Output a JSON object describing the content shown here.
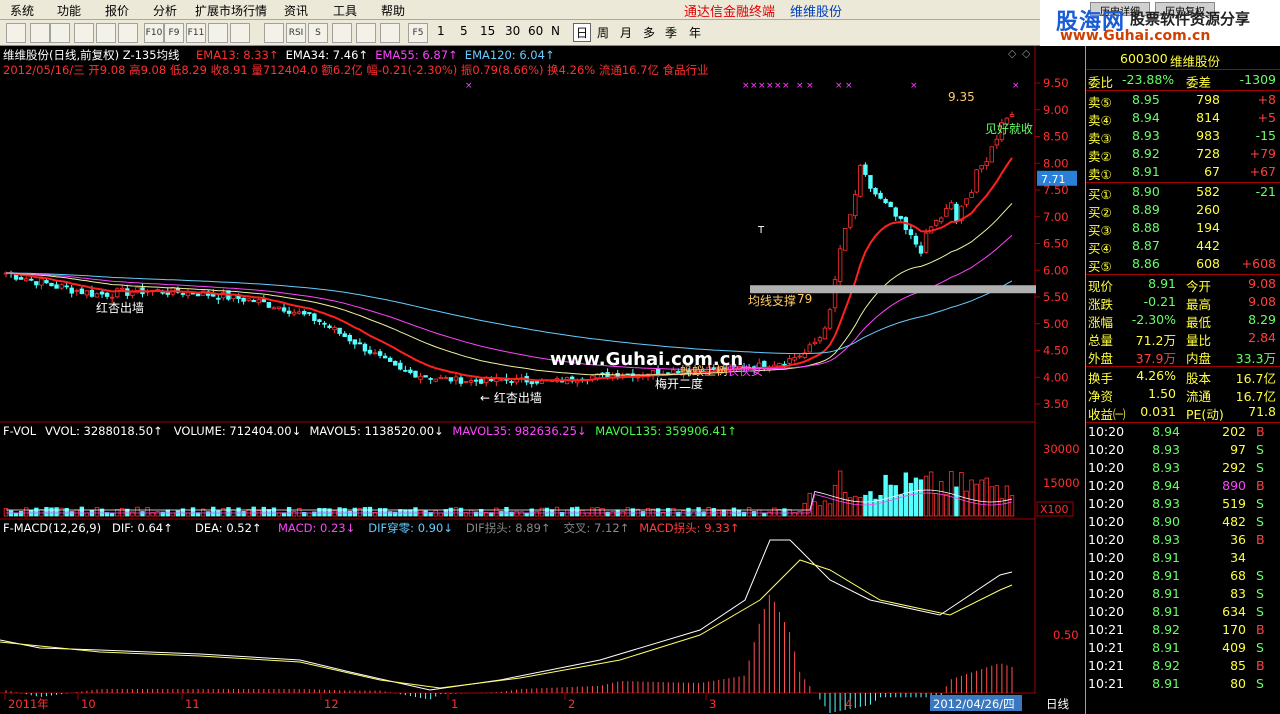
{
  "menu": [
    "系统",
    "功能",
    "报价",
    "分析",
    "扩展市场行情",
    "资讯",
    "工具",
    "帮助"
  ],
  "promo": "通达信金融终端",
  "stock_name_top": "维维股份",
  "brand": {
    "logo": "股海网",
    "slogan": "股票软件资源分享",
    "url": "www.Guhai.com.cn",
    "tabs": [
      "历史详细",
      "历史复权"
    ]
  },
  "toolbar": {
    "icons": [
      "k-line-icon",
      "bar-icon",
      "trend-icon",
      "candle-icon",
      "window-icon",
      "grid-icon",
      "f10-icon",
      "f9-icon",
      "f11-icon",
      "chart-icon",
      "comp-icon",
      "indicator-icon",
      "rsi-icon",
      "s-icon",
      "move-icon",
      "export-icon",
      "pen-icon",
      "f5-icon"
    ],
    "icon_labels": [
      "",
      "",
      "",
      "",
      "",
      "",
      "F10",
      "F9",
      "F11",
      "",
      "",
      "",
      "RSI",
      "S",
      "",
      "",
      "",
      "F5"
    ],
    "periods": [
      "1",
      "5",
      "15",
      "30",
      "60",
      "N",
      "日",
      "周",
      "月",
      "多",
      "季",
      "年"
    ],
    "selected_period": "日"
  },
  "price_panel": {
    "title": "维维股份(日线,前复权)",
    "indicator": "Z-135均线",
    "emas": [
      {
        "label": "EMA13: 8.33",
        "color": "#ff3030"
      },
      {
        "label": "EMA34: 7.46",
        "color": "#ffffff"
      },
      {
        "label": "EMA55: 6.87",
        "color": "#ff44ff"
      },
      {
        "label": "EMA120: 6.04",
        "color": "#66ccff"
      }
    ],
    "info_line": "2012/05/16/三 开9.08 高9.08 低8.29 收8.91 量712404.0 额6.2亿 幅-0.21(-2.30%) 振0.79(8.66%) 换4.26% 流通16.7亿 食品行业",
    "y_ticks": [
      "9.50",
      "9.00",
      "8.50",
      "8.00",
      "7.50",
      "7.00",
      "6.50",
      "6.00",
      "5.50",
      "5.00",
      "4.50",
      "4.00",
      "3.50"
    ],
    "current_price_tag": "7.71",
    "annotations": {
      "high_label": "9.35",
      "sell_signal": "见好就收",
      "red_apricot_1": "红杏出墙",
      "red_apricot_2": "红杏出墙",
      "plum": "梅开二度",
      "ant": "蚂蚁上树",
      "heroine": "农侠女",
      "ma_support": "均线支撑",
      "support_val": "79",
      "marker": "T"
    },
    "watermark": "www.Guhai.com.cn"
  },
  "vol_panel": {
    "title": "F-VOL",
    "labels": [
      {
        "label": "VVOL: 3288018.50↑",
        "color": "#ffffff"
      },
      {
        "label": "VOLUME: 712404.00↓",
        "color": "#ffffff"
      },
      {
        "label": "MAVOL5: 1138520.00↓",
        "color": "#ffffff"
      },
      {
        "label": "MAVOL35: 982636.25↓",
        "color": "#ff44ff"
      },
      {
        "label": "MAVOL135: 359906.41↑",
        "color": "#44ff44"
      }
    ],
    "y_ticks": [
      "30000",
      "15000",
      "X100"
    ]
  },
  "macd_panel": {
    "title": "F-MACD(12,26,9)",
    "labels": [
      {
        "label": "DIF: 0.64↑",
        "color": "#ffffff"
      },
      {
        "label": "DEA: 0.52↑",
        "color": "#ffffff"
      },
      {
        "label": "MACD: 0.23↓",
        "color": "#ff44ff"
      },
      {
        "label": "DIF穿零: 0.90↓",
        "color": "#66ccff"
      },
      {
        "label": "DIF拐头: 8.89↑",
        "color": "#888888"
      },
      {
        "label": "交叉: 7.12↑",
        "color": "#888888"
      },
      {
        "label": "MACD拐头: 9.33↑",
        "color": "#ff4040"
      }
    ],
    "y_tick": "0.50"
  },
  "x_axis": {
    "labels": [
      "2011年",
      "10",
      "11",
      "12",
      "1",
      "2",
      "3",
      "4"
    ],
    "date_box": "2012/04/26/四",
    "period": "日线"
  },
  "quote": {
    "code": "600300",
    "name": "维维股份",
    "weibi_label": "委比",
    "weibi": "-23.88%",
    "weicha_label": "委差",
    "weicha": "-1309",
    "asks": [
      {
        "label": "卖⑤",
        "price": "8.95",
        "vol": "798",
        "chg": "+8"
      },
      {
        "label": "卖④",
        "price": "8.94",
        "vol": "814",
        "chg": "+5"
      },
      {
        "label": "卖③",
        "price": "8.93",
        "vol": "983",
        "chg": "-15"
      },
      {
        "label": "卖②",
        "price": "8.92",
        "vol": "728",
        "chg": "+79"
      },
      {
        "label": "卖①",
        "price": "8.91",
        "vol": "67",
        "chg": "+67"
      }
    ],
    "bids": [
      {
        "label": "买①",
        "price": "8.90",
        "vol": "582",
        "chg": "-21"
      },
      {
        "label": "买②",
        "price": "8.89",
        "vol": "260",
        "chg": ""
      },
      {
        "label": "买③",
        "price": "8.88",
        "vol": "194",
        "chg": ""
      },
      {
        "label": "买④",
        "price": "8.87",
        "vol": "442",
        "chg": ""
      },
      {
        "label": "买⑤",
        "price": "8.86",
        "vol": "608",
        "chg": "+608"
      }
    ],
    "stats": [
      {
        "l1": "现价",
        "v1": "8.91",
        "l2": "今开",
        "v2": "9.08",
        "c1": "#66ff66",
        "c2": "#ff4040"
      },
      {
        "l1": "涨跌",
        "v1": "-0.21",
        "l2": "最高",
        "v2": "9.08",
        "c1": "#66ff66",
        "c2": "#ff4040"
      },
      {
        "l1": "涨幅",
        "v1": "-2.30%",
        "l2": "最低",
        "v2": "8.29",
        "c1": "#66ff66",
        "c2": "#66ff66"
      },
      {
        "l1": "总量",
        "v1": "71.2万",
        "l2": "量比",
        "v2": "2.84",
        "c1": "#ffff40",
        "c2": "#ff4040"
      },
      {
        "l1": "外盘",
        "v1": "37.9万",
        "l2": "内盘",
        "v2": "33.3万",
        "c1": "#ff4040",
        "c2": "#66ff66"
      },
      {
        "l1": "换手",
        "v1": "4.26%",
        "l2": "股本",
        "v2": "16.7亿",
        "c1": "#ffff40",
        "c2": "#ffff40"
      },
      {
        "l1": "净资",
        "v1": "1.50",
        "l2": "流通",
        "v2": "16.7亿",
        "c1": "#ffff40",
        "c2": "#ffff40"
      },
      {
        "l1": "收益㈠",
        "v1": "0.031",
        "l2": "PE(动)",
        "v2": "71.8",
        "c1": "#ffff40",
        "c2": "#ffff40"
      }
    ],
    "ticks": [
      {
        "t": "10:20",
        "p": "8.94",
        "v": "202",
        "d": "B"
      },
      {
        "t": "10:20",
        "p": "8.93",
        "v": "97",
        "d": "S"
      },
      {
        "t": "10:20",
        "p": "8.93",
        "v": "292",
        "d": "S"
      },
      {
        "t": "10:20",
        "p": "8.94",
        "v": "890",
        "d": "B"
      },
      {
        "t": "10:20",
        "p": "8.93",
        "v": "519",
        "d": "S"
      },
      {
        "t": "10:20",
        "p": "8.90",
        "v": "482",
        "d": "S"
      },
      {
        "t": "10:20",
        "p": "8.93",
        "v": "36",
        "d": "B"
      },
      {
        "t": "10:20",
        "p": "8.91",
        "v": "34",
        "d": ""
      },
      {
        "t": "10:20",
        "p": "8.91",
        "v": "68",
        "d": "S"
      },
      {
        "t": "10:20",
        "p": "8.91",
        "v": "83",
        "d": "S"
      },
      {
        "t": "10:20",
        "p": "8.91",
        "v": "634",
        "d": "S"
      },
      {
        "t": "10:21",
        "p": "8.92",
        "v": "170",
        "d": "B"
      },
      {
        "t": "10:21",
        "p": "8.91",
        "v": "409",
        "d": "S"
      },
      {
        "t": "10:21",
        "p": "8.92",
        "v": "85",
        "d": "B"
      },
      {
        "t": "10:21",
        "p": "8.91",
        "v": "80",
        "d": "S"
      }
    ],
    "tick_big_vol": "890"
  }
}
